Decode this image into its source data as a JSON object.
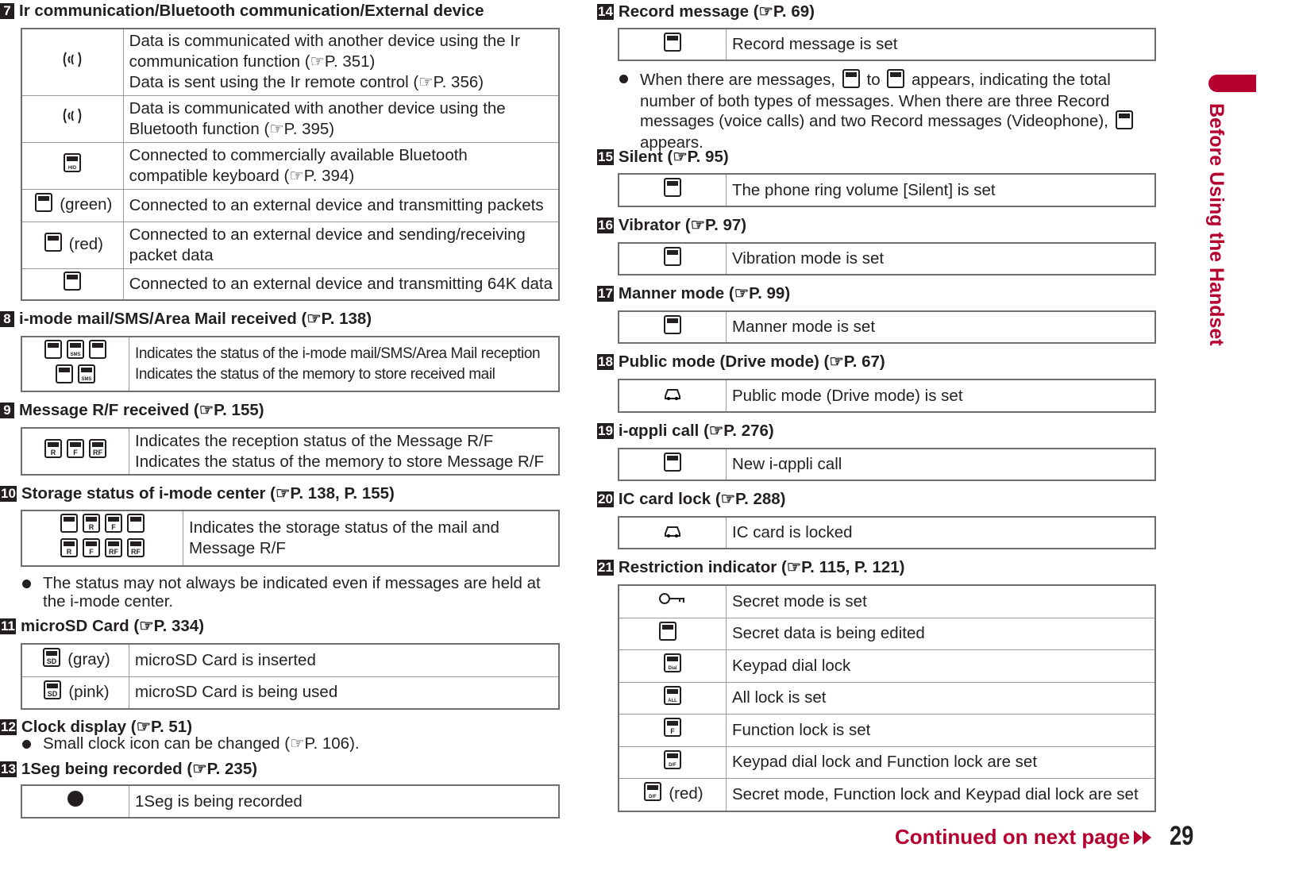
{
  "sidebar_title": "Before Using the Handset",
  "footer": {
    "continued": "Continued on next page",
    "continued_icon": "double-arrow-right-icon",
    "page_number": "29"
  },
  "accent_color": "#b5002f",
  "left": [
    {
      "marker": "7",
      "title": "Ir communication/Bluetooth communication/External device",
      "rows": [
        {
          "icons": [
            "ir-communication-icon"
          ],
          "note": "",
          "lines": [
            "Data is communicated with another device using the Ir",
            "communication function (☞P. 351)",
            "Data is sent using the Ir remote control (☞P. 356)"
          ]
        },
        {
          "icons": [
            "bluetooth-communication-icon"
          ],
          "note": "",
          "lines": [
            "Data is communicated with another device using the",
            "Bluetooth function (☞P. 395)"
          ]
        },
        {
          "icons": [
            "bluetooth-hid-icon"
          ],
          "note": "",
          "lines": [
            "Connected to commercially available Bluetooth",
            "compatible keyboard (☞P. 394)"
          ]
        },
        {
          "icons": [
            "external-device-packet-icon"
          ],
          "note": "(green)",
          "lines": [
            "Connected to an external device and transmitting packets"
          ]
        },
        {
          "icons": [
            "external-device-packet-icon"
          ],
          "note": "(red)",
          "lines": [
            "Connected to an external device and sending/receiving",
            "packet data"
          ]
        },
        {
          "icons": [
            "external-device-64k-icon"
          ],
          "note": "",
          "lines": [
            "Connected to an external device and transmitting 64K data"
          ]
        }
      ]
    },
    {
      "marker": "8",
      "title": "i-mode mail/SMS/Area Mail received (☞P. 138)",
      "rows": [
        {
          "icons": [
            "imode-mail-icon",
            "sms-icon",
            "mail-icon",
            "area-mail-icon",
            "sms-full-icon"
          ],
          "note": "",
          "cond": true,
          "lines": [
            "Indicates the status of the i-mode mail/SMS/Area Mail reception",
            "Indicates the status of the memory to store received mail"
          ]
        }
      ]
    },
    {
      "marker": "9",
      "title": "Message R/F received (☞P. 155)",
      "rows": [
        {
          "icons": [
            "message-r-icon",
            "message-f-icon",
            "message-rf-icon"
          ],
          "note": "",
          "lines": [
            "Indicates the reception status of the Message R/F",
            "Indicates the status of the memory to store Message R/F"
          ]
        }
      ]
    },
    {
      "marker": "10",
      "title": "Storage status of i-mode center (☞P. 138, P. 155)",
      "rows": [
        {
          "icons": [
            "center-mail-icon",
            "center-r-icon",
            "center-f-icon",
            "center-mail-full-icon",
            "center-r-full-icon",
            "center-f-full-icon",
            "center-rf-icon",
            "center-rf-full-icon"
          ],
          "note": "",
          "lines": [
            "Indicates the storage status of the mail and",
            "Message R/F"
          ]
        }
      ],
      "bullets": [
        [
          "The status may not always be indicated even if messages are held at",
          "the i-mode center."
        ]
      ]
    },
    {
      "marker": "11",
      "title": "microSD Card (☞P. 334)",
      "rows": [
        {
          "icons": [
            "microsd-icon"
          ],
          "note": "(gray)",
          "lines": [
            "microSD Card is inserted"
          ]
        },
        {
          "icons": [
            "microsd-icon"
          ],
          "note": "(pink)",
          "lines": [
            "microSD Card is being used"
          ]
        }
      ]
    },
    {
      "marker": "12",
      "title": "Clock display (☞P. 51)",
      "bullets": [
        [
          "Small clock icon can be changed (☞P. 106)."
        ]
      ]
    },
    {
      "marker": "13",
      "title": "1Seg being recorded (☞P. 235)",
      "rows": [
        {
          "icons": [
            "1seg-recording-icon"
          ],
          "note": "",
          "lines": [
            "1Seg is being recorded"
          ]
        }
      ]
    }
  ],
  "right": [
    {
      "marker": "14",
      "title": "Record message (☞P. 69)",
      "rows": [
        {
          "icons": [
            "record-message-icon"
          ],
          "note": "",
          "lines": [
            "Record message is set"
          ]
        }
      ],
      "bullets": [
        [
          "When there are messages, [icon] to [icon] appears, indicating the total",
          "number of both types of messages. When there are three Record",
          "messages (voice calls) and two Record messages (Videophone), [icon]",
          "appears."
        ]
      ],
      "bullet_icons": [
        "record-message-1-icon",
        "record-message-full-icon",
        "record-message-3-2-icon"
      ]
    },
    {
      "marker": "15",
      "title": "Silent (☞P. 95)",
      "rows": [
        {
          "icons": [
            "silent-icon"
          ],
          "note": "",
          "lines": [
            "The phone ring volume [Silent] is set"
          ]
        }
      ]
    },
    {
      "marker": "16",
      "title": "Vibrator (☞P. 97)",
      "rows": [
        {
          "icons": [
            "vibrator-icon"
          ],
          "note": "",
          "lines": [
            "Vibration mode is set"
          ]
        }
      ]
    },
    {
      "marker": "17",
      "title": "Manner mode (☞P. 99)",
      "rows": [
        {
          "icons": [
            "manner-mode-icon"
          ],
          "note": "",
          "lines": [
            "Manner mode is set"
          ]
        }
      ]
    },
    {
      "marker": "18",
      "title": "Public mode (Drive mode) (☞P. 67)",
      "rows": [
        {
          "icons": [
            "drive-mode-car-icon"
          ],
          "note": "",
          "lines": [
            "Public mode (Drive mode) is set"
          ]
        }
      ]
    },
    {
      "marker": "19",
      "title": "i-αppli call (☞P. 276)",
      "rows": [
        {
          "icons": [
            "iappli-call-icon"
          ],
          "note": "",
          "lines": [
            "New i-αppli call"
          ]
        }
      ]
    },
    {
      "marker": "20",
      "title": "IC card lock (☞P. 288)",
      "rows": [
        {
          "icons": [
            "ic-card-lock-icon"
          ],
          "note": "",
          "lines": [
            "IC card is locked"
          ]
        }
      ]
    },
    {
      "marker": "21",
      "title": "Restriction indicator (☞P. 115, P. 121)",
      "rows": [
        {
          "icons": [
            "secret-mode-key-icon"
          ],
          "note": "",
          "lines": [
            "Secret mode is set"
          ]
        },
        {
          "icons": [
            "secret-data-edit-icon"
          ],
          "note": "",
          "lines": [
            "Secret data is being edited"
          ]
        },
        {
          "icons": [
            "dial-lock-icon"
          ],
          "note": "",
          "lines": [
            "Keypad dial lock"
          ]
        },
        {
          "icons": [
            "all-lock-icon"
          ],
          "note": "",
          "lines": [
            "All lock is set"
          ]
        },
        {
          "icons": [
            "function-lock-icon"
          ],
          "note": "",
          "lines": [
            "Function lock is set"
          ]
        },
        {
          "icons": [
            "dial-function-lock-icon"
          ],
          "note": "",
          "lines": [
            "Keypad dial lock and Function lock are set"
          ]
        },
        {
          "icons": [
            "secret-function-dial-lock-icon"
          ],
          "note": "(red)",
          "lines": [
            "Secret mode, Function lock and Keypad dial lock are set"
          ]
        }
      ]
    }
  ]
}
